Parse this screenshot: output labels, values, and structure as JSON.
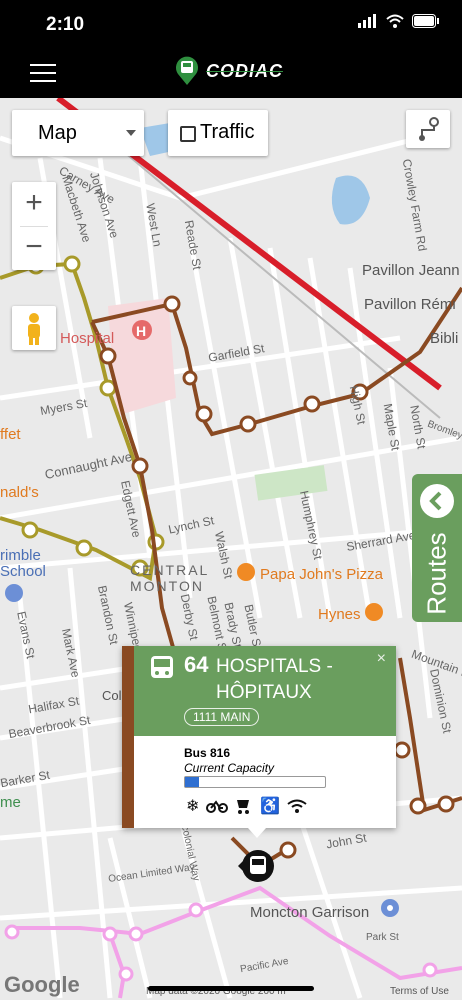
{
  "status": {
    "time": "2:10"
  },
  "nav": {
    "logo_text": "CODIAC"
  },
  "map_controls": {
    "map_type": "Map",
    "traffic_label": "Traffic",
    "zoom_in": "+",
    "zoom_out": "−"
  },
  "map_labels": {
    "streets": [
      "Carney Ave",
      "Macbeth Ave",
      "Johnson Ave",
      "West Ln",
      "Reade St",
      "Crowley Farm Rd",
      "Garfield St",
      "Myers St",
      "Connaught Ave",
      "Edgett Ave",
      "Lynch St",
      "Walsh St",
      "Humphrey St",
      "High St",
      "Maple St",
      "North St",
      "Sherrard Ave",
      "Dominion St",
      "Derby St",
      "Belmont St",
      "Brady St",
      "Butler St",
      "Winnipeg",
      "Brandon St",
      "Evans St",
      "Mark Ave",
      "Halifax St",
      "Beaverbrook St",
      "Barker St",
      "Ocean Limited Way",
      "Intercolonial Way",
      "Park St",
      "Pacific Ave",
      "Mountain Rd",
      "John St",
      "Bromley Ave"
    ],
    "places": [
      "Pavillon Jeann",
      "Pavillon Rémi",
      "Bibli",
      "Hospital",
      "ffet",
      "nald's",
      "rimble School",
      "CENTRAL MONTON",
      "Papa John's Pizza",
      "Hynes",
      "Moncton Garrison",
      "me",
      "Col"
    ]
  },
  "routes_tab": {
    "label": "Routes"
  },
  "popup": {
    "route_number": "64",
    "route_name": "HOSPITALS - HÔPITAUX",
    "stop": "1111 MAIN",
    "bus_label": "Bus 816",
    "capacity_label": "Current Capacity",
    "capacity_fraction": 0.1,
    "close": "×",
    "amenities": [
      "snowflake-icon",
      "bicycle-icon",
      "stroller-icon",
      "wheelchair-icon",
      "wifi-icon"
    ]
  },
  "footer": {
    "google": "Google",
    "attribution": "Map data ©2020 Google   200 m",
    "terms": "Terms of Use"
  },
  "colors": {
    "route_brown": "#8a4a22",
    "route_olive": "#a89a2a",
    "route_red": "#d81e2a",
    "route_pink": "#f2a2e8",
    "green": "#6a9e5e"
  }
}
